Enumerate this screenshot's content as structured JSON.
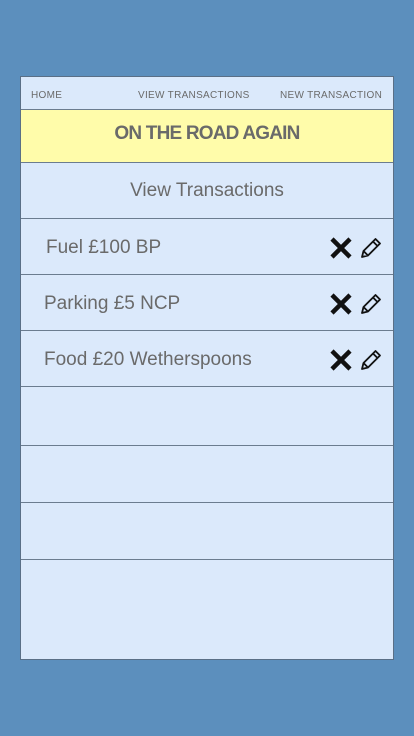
{
  "nav": {
    "home": "HOME",
    "view_transactions": "VIEW TRANSACTIONS",
    "new_transaction": "NEW TRANSACTION"
  },
  "banner": {
    "title": "ON THE ROAD AGAIN"
  },
  "section": {
    "title": "View Transactions"
  },
  "transactions": [
    {
      "label": "Fuel £100 BP"
    },
    {
      "label": "Parking £5 NCP"
    },
    {
      "label": "Food £20 Wetherspoons"
    }
  ],
  "icons": {
    "delete": "close-x-icon",
    "edit": "pencil-icon"
  },
  "colors": {
    "background": "#5c8fbd",
    "panel": "#dbe9fb",
    "banner": "#fffcaa",
    "text": "#6a6a6a"
  }
}
